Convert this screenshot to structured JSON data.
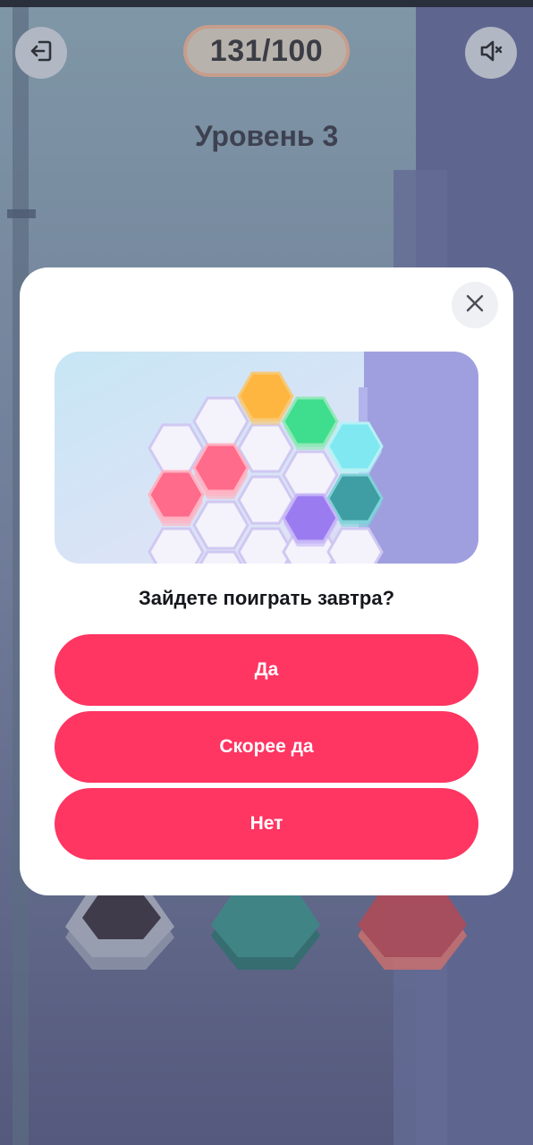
{
  "header": {
    "exit_icon": "exit-icon",
    "score": "131/100",
    "sound_icon": "speaker-off-icon",
    "level_title": "Уровень 3"
  },
  "dialog": {
    "close_icon": "close-icon",
    "question": "Зайдете поиграть завтра?",
    "buttons": {
      "yes": "Да",
      "likely_yes": "Скорее да",
      "no": "Нет"
    }
  },
  "colors": {
    "accent": "#ff3562",
    "dialog_bg": "#ffffff",
    "backdrop": "#7c86a3",
    "hex_orange": "#ffb640",
    "hex_green": "#3fdd8e",
    "hex_cyan": "#7fe8f0",
    "hex_pink": "#ff6b8a",
    "hex_teal": "#3f9ea3",
    "hex_purple": "#9b7cf0"
  }
}
